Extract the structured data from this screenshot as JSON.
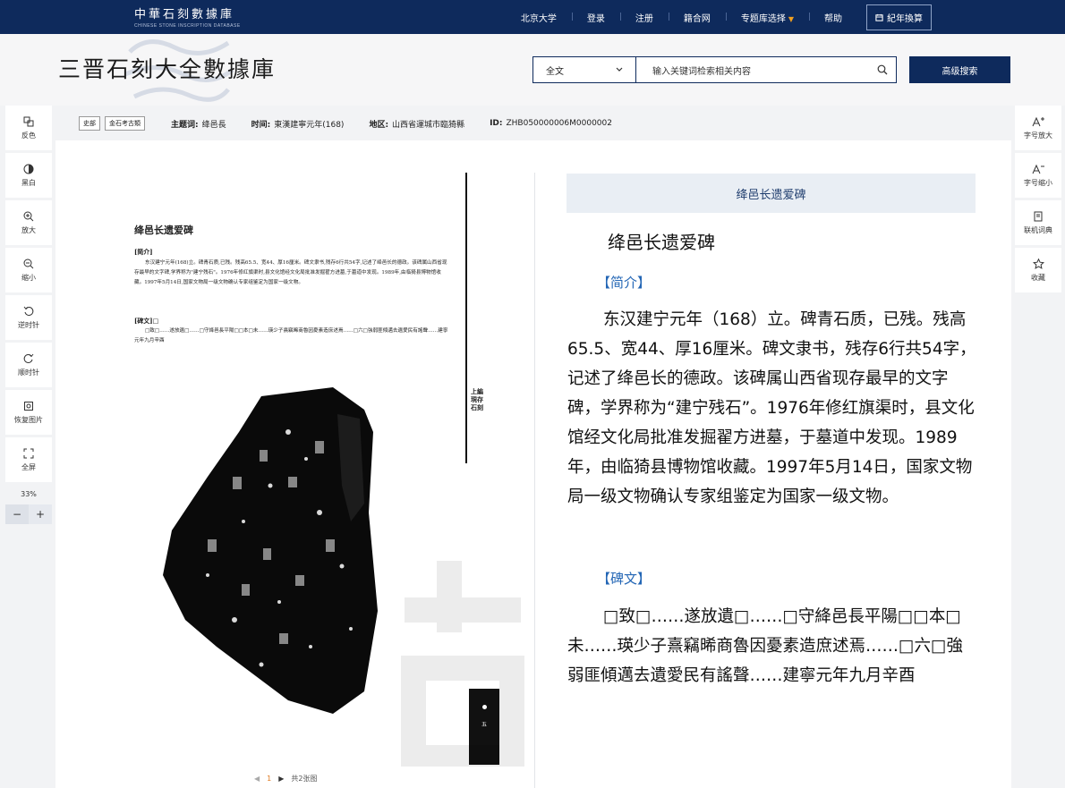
{
  "topbar": {
    "logo_cn": "中華石刻數據庫",
    "logo_en": "CHINESE STONE INSCRIPTION DATABASE",
    "nav": [
      {
        "label": "北京大学"
      },
      {
        "label": "登录"
      },
      {
        "label": "注册"
      },
      {
        "label": "籍合网"
      },
      {
        "label": "专题库选择"
      },
      {
        "label": "帮助"
      }
    ],
    "calendar_button": "紀年換算"
  },
  "header": {
    "title": "三晋石刻大全數據庫",
    "search_scope": "全文",
    "search_placeholder": "输入关键词检索相关内容",
    "advanced_search": "高级搜索"
  },
  "left_tools": [
    {
      "label": "反色",
      "icon": "invert-color-icon"
    },
    {
      "label": "黑白",
      "icon": "grayscale-icon"
    },
    {
      "label": "放大",
      "icon": "zoom-in-icon"
    },
    {
      "label": "缩小",
      "icon": "zoom-out-icon"
    },
    {
      "label": "逆时针",
      "icon": "rotate-ccw-icon"
    },
    {
      "label": "顺时针",
      "icon": "rotate-cw-icon"
    },
    {
      "label": "恢复图片",
      "icon": "restore-image-icon"
    },
    {
      "label": "全屏",
      "icon": "fullscreen-icon"
    }
  ],
  "zoom": {
    "percent": "33%",
    "minus": "−",
    "plus": "+"
  },
  "right_tools": [
    {
      "label": "字号放大",
      "icon": "font-increase-icon"
    },
    {
      "label": "字号缩小",
      "icon": "font-decrease-icon"
    },
    {
      "label": "联机词典",
      "icon": "dictionary-icon"
    },
    {
      "label": "收藏",
      "icon": "star-icon"
    }
  ],
  "infobar": {
    "tags": [
      "史部",
      "金石考古類"
    ],
    "subject_label": "主题词:",
    "subject": "绛邑長",
    "time_label": "时间:",
    "time": "東漢建寧元年(168)",
    "region_label": "地区:",
    "region": "山西省運城市臨猗縣",
    "id_label": "ID:",
    "id": "ZHB050000006M0000002"
  },
  "page_image": {
    "title": "绛邑长遗爱碑",
    "sec_intro": "[简介]",
    "intro": "东汉建宁元年(168)立。碑青石质,已残。残高65.5、宽44、厚16厘米。碑文隶书,残存6行共54字,记述了绛邑长的德政。该碑属山西省现存最早的文字碑,学界称为\"建宁残石\"。1976年修红旗渠时,县文化馆经文化局批准发掘翟方进墓,于墓道中发现。1989年,由临猗县博物馆收藏。1997年5月14日,国家文物局一级文物确认专家组鉴定为国家一级文物。",
    "sec_text": "[碑文]□",
    "inscription": "□致□……遂放遺□……□守絳邑長平陽□□本□未……瑛少子熹竊晞商魯因憂素造庶述焉……□六□強弱匪傾邁去遺愛民有謠聲……建寧元年九月辛酉",
    "side_label": "上編 現存石刻",
    "tab_number": "五"
  },
  "pager": {
    "current": "1",
    "total": "共2张图"
  },
  "text_panel": {
    "header": "绛邑长遗爱碑",
    "title": "绛邑长遗爱碑",
    "sec_intro": "【简介】",
    "intro": "东汉建宁元年（168）立。碑青石质，已残。残高65.5、宽44、厚16厘米。碑文隶书，残存6行共54字，记述了绛邑长的德政。该碑属山西省现存最早的文字碑，学界称为“建宁残石”。1976年修红旗渠时，县文化馆经文化局批准发掘翟方进墓，于墓道中发现。1989年，由临猗县博物馆收藏。1997年5月14日，国家文物局一级文物确认专家组鉴定为国家一级文物。",
    "sec_text": "【碑文】",
    "inscription": "□致□……遂放遺□……□守絳邑長平陽□□本□未……瑛少子熹竊晞商魯因憂素造庶述焉……□六□強弱匪傾邁去遺愛民有謠聲……建寧元年九月辛酉"
  },
  "colors": {
    "nav_bg": "#0e2a5c",
    "accent": "#2366b5",
    "pager_current": "#e07a20"
  }
}
